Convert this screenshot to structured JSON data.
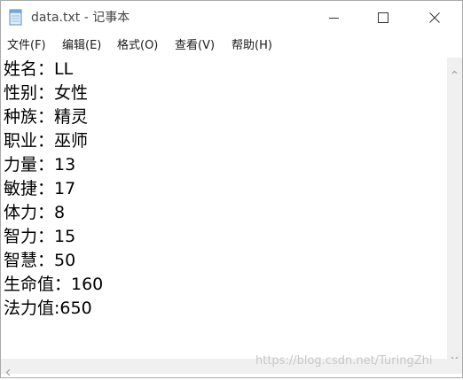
{
  "window": {
    "title": "data.txt - 记事本",
    "icons": {
      "app": "notepad-icon",
      "minimize": "minimize-icon",
      "maximize": "maximize-icon",
      "close": "close-icon"
    }
  },
  "menu": {
    "items": [
      {
        "label": "文件(F)"
      },
      {
        "label": "编辑(E)"
      },
      {
        "label": "格式(O)"
      },
      {
        "label": "查看(V)"
      },
      {
        "label": "帮助(H)"
      }
    ]
  },
  "document": {
    "lines": [
      "姓名：LL",
      "性别：女性",
      "种族：精灵",
      "职业：巫师",
      "力量：13",
      "敏捷：17",
      "体力：8",
      "智力：15",
      "智慧：50",
      "生命值：160",
      "法力值:650"
    ]
  },
  "watermark": "https://blog.csdn.net/TuringZhi",
  "colors": {
    "scrollbar": "#f0f0f0",
    "text": "#000000",
    "border": "#aaaaaa"
  }
}
